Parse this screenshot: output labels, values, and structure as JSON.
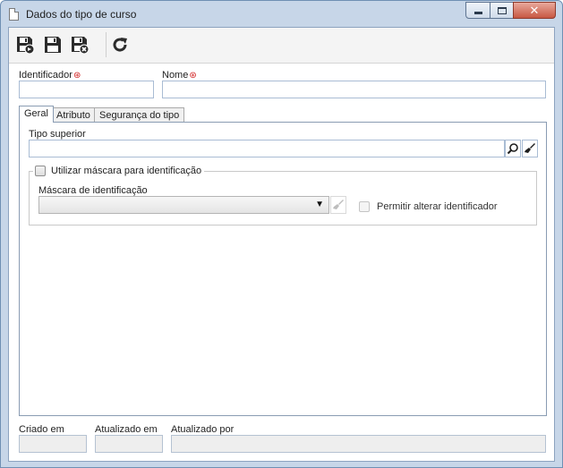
{
  "window": {
    "title": "Dados do tipo de curso",
    "icon": "document-icon",
    "controls": {
      "minimize_icon": "minimize-icon",
      "maximize_icon": "maximize-icon",
      "close_icon": "close-icon",
      "close_glyph": "✕"
    }
  },
  "toolbar": {
    "buttons": [
      {
        "name": "save-and-new",
        "icon": "save-new-icon"
      },
      {
        "name": "save",
        "icon": "save-icon"
      },
      {
        "name": "save-and-close",
        "icon": "save-close-icon"
      },
      {
        "name": "refresh",
        "icon": "refresh-icon"
      }
    ]
  },
  "form": {
    "identificador": {
      "label": "Identificador",
      "value": ""
    },
    "nome": {
      "label": "Nome",
      "value": ""
    },
    "required_marker": "⊛"
  },
  "tabs": [
    {
      "label": "Geral",
      "active": true
    },
    {
      "label": "Atributo",
      "active": false
    },
    {
      "label": "Segurança do tipo",
      "active": false
    }
  ],
  "geral": {
    "tipo_superior": {
      "label": "Tipo superior",
      "value": "",
      "search_icon": "search-icon",
      "clear_icon": "eraser-icon"
    },
    "usar_mascara": {
      "label": "Utilizar máscara para identificação",
      "checked": false
    },
    "mascara": {
      "label": "Máscara de identificação",
      "value": "",
      "arrow": "▼",
      "edit_icon": "eraser-icon"
    },
    "permitir_alterar": {
      "label": "Permitir alterar identificador",
      "checked": false,
      "disabled": true
    }
  },
  "footer": {
    "criado_em": {
      "label": "Criado em",
      "value": ""
    },
    "atualizado_em": {
      "label": "Atualizado em",
      "value": ""
    },
    "atualizado_por": {
      "label": "Atualizado por",
      "value": ""
    }
  },
  "colors": {
    "window_frame": "#c7d6e8",
    "required": "#d01c1c",
    "close_button": "#c75843",
    "input_border": "#a9bcd4"
  }
}
